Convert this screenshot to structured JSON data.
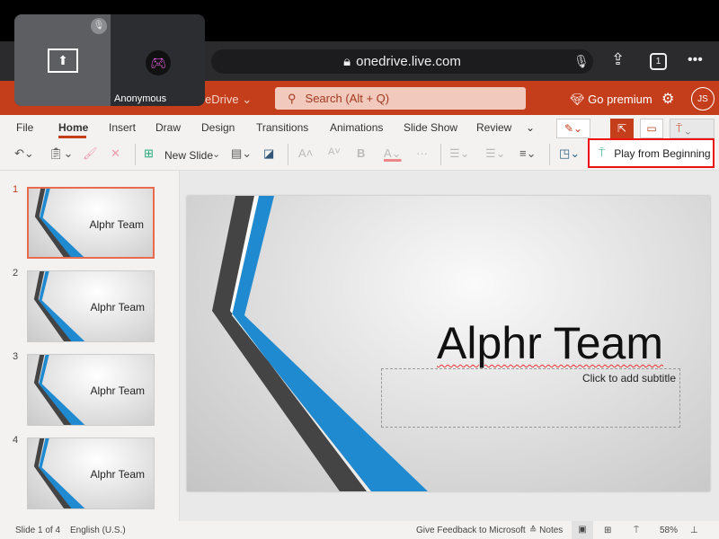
{
  "browser": {
    "url": "onedrive.live.com",
    "tabs_count": "1"
  },
  "pip": {
    "name": "Anonymous"
  },
  "header": {
    "app_crumb": "eDrive",
    "search_placeholder": "Search (Alt + Q)",
    "premium": "Go premium",
    "avatar": "JS"
  },
  "tabs": [
    {
      "label": "File"
    },
    {
      "label": "Home",
      "active": true
    },
    {
      "label": "Insert"
    },
    {
      "label": "Draw"
    },
    {
      "label": "Design"
    },
    {
      "label": "Transitions"
    },
    {
      "label": "Animations"
    },
    {
      "label": "Slide Show"
    },
    {
      "label": "Review"
    }
  ],
  "toolbar": {
    "new_slide": "New Slide",
    "play_from_beginning": "Play from Beginning"
  },
  "slides": [
    {
      "num": "1",
      "title": "Alphr Team"
    },
    {
      "num": "2",
      "title": "Alphr Team"
    },
    {
      "num": "3",
      "title": "Alphr Team"
    },
    {
      "num": "4",
      "title": "Alphr Team"
    }
  ],
  "slide": {
    "title": "Alphr Team",
    "subtitle_placeholder": "Click to add subtitle"
  },
  "status": {
    "slide": "Slide 1 of 4",
    "language": "English (U.S.)",
    "feedback": "Give Feedback to Microsoft",
    "notes": "Notes",
    "zoom": "58%"
  },
  "colors": {
    "accent": "#c43e1c",
    "highlight": "#e11111",
    "stripe_blue": "#1f8ad0",
    "stripe_dark": "#444444"
  }
}
